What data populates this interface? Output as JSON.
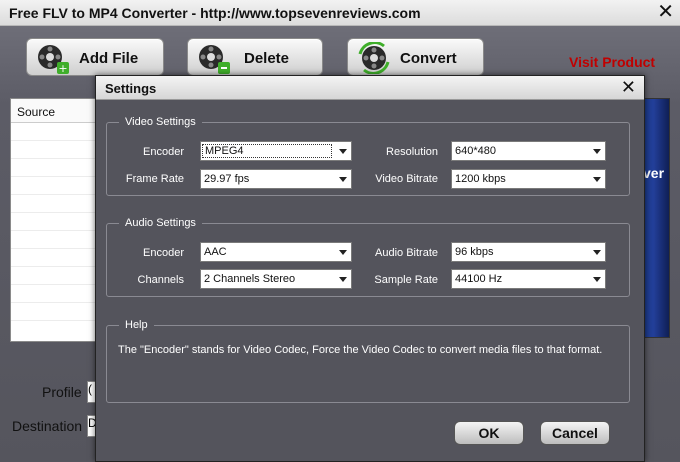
{
  "window": {
    "title": "Free FLV to MP4 Converter - http://www.topsevenreviews.com",
    "close_glyph": "✕"
  },
  "toolbar": {
    "add_file": {
      "label": "Add File",
      "icon": "film-add-icon"
    },
    "delete": {
      "label": "Delete",
      "icon": "film-remove-icon"
    },
    "convert": {
      "label": "Convert",
      "icon": "film-convert-icon"
    },
    "visit_product": "Visit Product"
  },
  "source_panel": {
    "header": "Source"
  },
  "lower": {
    "profile_label": "Profile",
    "destination_label": "Destination",
    "destination_value": "D",
    "profile_value": "("
  },
  "preview": {
    "text": "ver"
  },
  "dialog": {
    "title": "Settings",
    "close_glyph": "✕",
    "video": {
      "legend": "Video Settings",
      "encoder_label": "Encoder",
      "encoder_value": "MPEG4",
      "resolution_label": "Resolution",
      "resolution_value": "640*480",
      "framerate_label": "Frame Rate",
      "framerate_value": "29.97 fps",
      "bitrate_label": "Video Bitrate",
      "bitrate_value": "1200 kbps"
    },
    "audio": {
      "legend": "Audio Settings",
      "encoder_label": "Encoder",
      "encoder_value": "AAC",
      "bitrate_label": "Audio Bitrate",
      "bitrate_value": "96 kbps",
      "channels_label": "Channels",
      "channels_value": "2 Channels Stereo",
      "samplerate_label": "Sample Rate",
      "samplerate_value": "44100 Hz"
    },
    "help": {
      "legend": "Help",
      "text": "The \"Encoder\" stands for Video Codec, Force the Video Codec to convert media files to that format."
    },
    "ok_label": "OK",
    "cancel_label": "Cancel"
  }
}
